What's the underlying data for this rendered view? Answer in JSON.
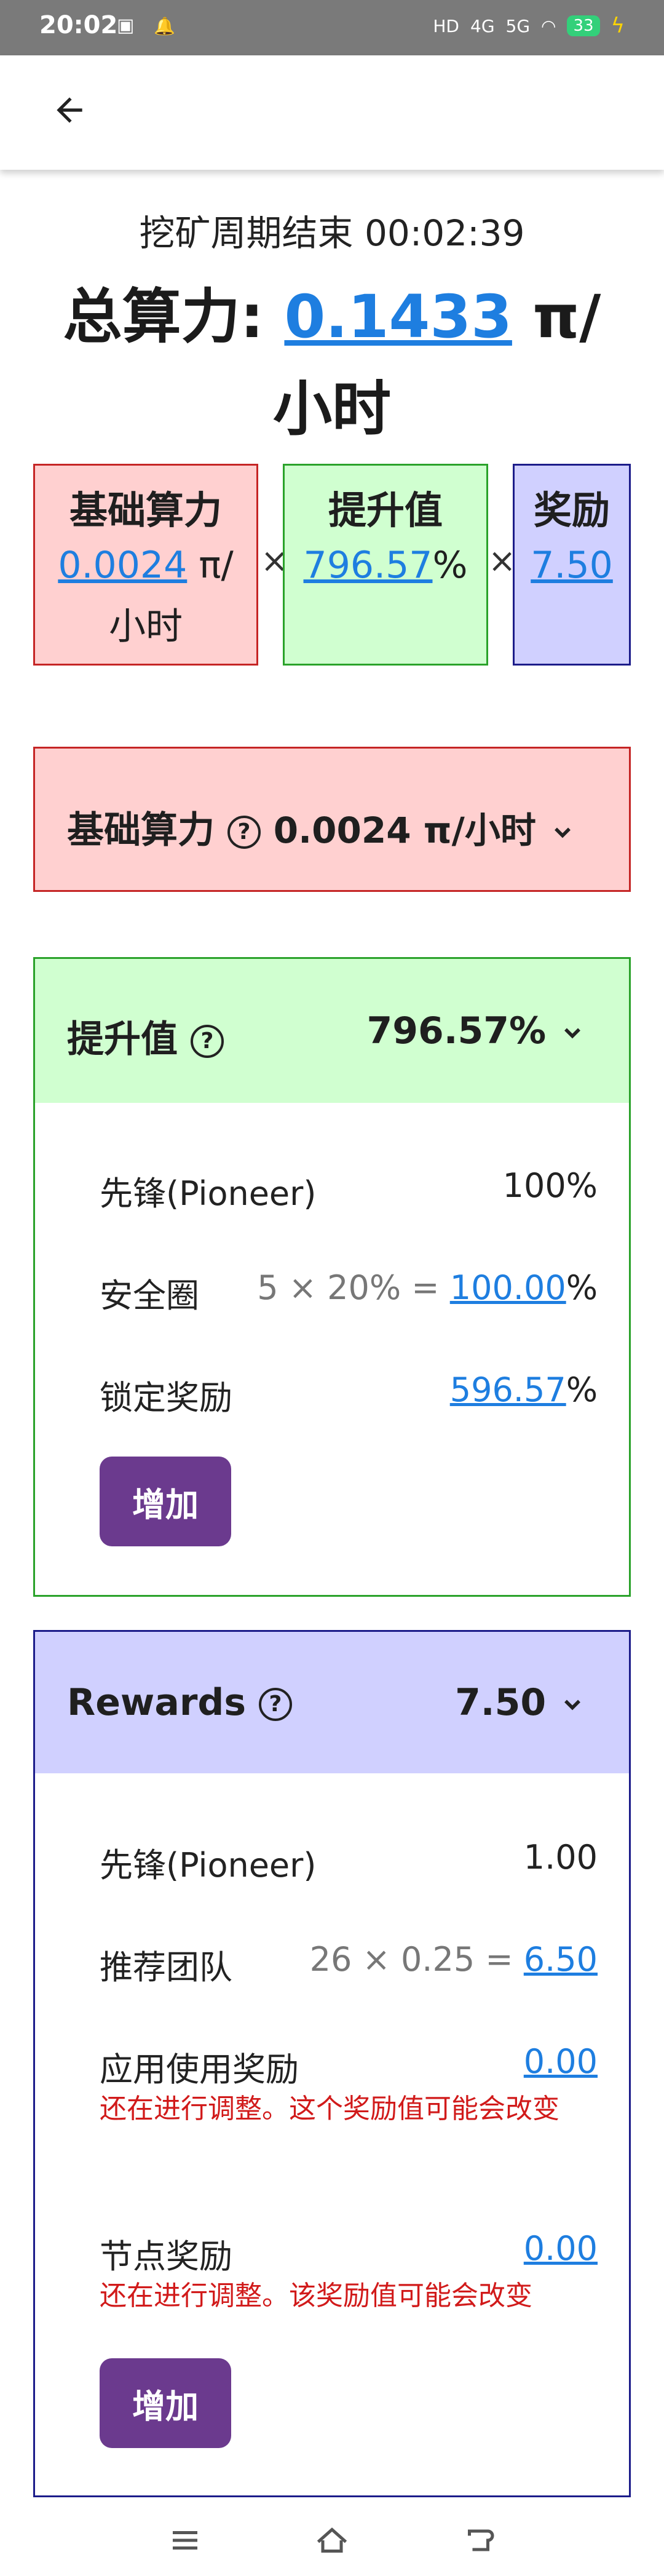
{
  "status_bar": {
    "time": "20:02",
    "notification_icons": [
      "app-notification-icon",
      "bell-icon"
    ],
    "battery_level": "33",
    "signal_labels": [
      "HD",
      "4G",
      "5G"
    ]
  },
  "header": {
    "back_icon": "arrow-left-icon"
  },
  "summary": {
    "timer_text": "挖矿周期结束 00:02:39",
    "total_label": "总算力:",
    "total_value": "0.1433",
    "total_unit": "π/小时"
  },
  "formula": {
    "base": {
      "title": "基础算力",
      "value": "0.0024",
      "unit_a": "π/",
      "unit_b": "小时"
    },
    "boost": {
      "title": "提升值",
      "value": "796.57",
      "unit": "%"
    },
    "reward": {
      "title": "奖励",
      "value": "7.50"
    },
    "times_symbol": "×"
  },
  "base_section": {
    "title": "基础算力",
    "value": "0.0024 π/小时",
    "help_icon": "question-circle-icon",
    "expand_icon": "chevron-down-icon"
  },
  "boost_section": {
    "title": "提升值",
    "value": "796.57%",
    "help_icon": "question-circle-icon",
    "expand_icon": "chevron-down-icon",
    "rows": [
      {
        "label": "先锋(Pioneer)",
        "formula": "",
        "value": "100%"
      },
      {
        "label": "安全圈",
        "formula": "5 × 20% =",
        "value_link": "100.00",
        "value_suffix": "%"
      },
      {
        "label": "锁定奖励",
        "formula": "",
        "value_link": "596.57",
        "value_suffix": "%"
      }
    ],
    "button_label": "增加"
  },
  "rewards_section": {
    "title": "Rewards",
    "value": "7.50",
    "help_icon": "question-circle-icon",
    "expand_icon": "chevron-down-icon",
    "rows": [
      {
        "label": "先锋(Pioneer)",
        "value": "1.00"
      },
      {
        "label": "推荐团队",
        "formula": "26 × 0.25 =",
        "value_link": "6.50"
      },
      {
        "label": "应用使用奖励",
        "value_link": "0.00",
        "note": "还在进行调整。这个奖励值可能会改变"
      },
      {
        "label": "节点奖励",
        "value_link": "0.00",
        "note": "还在进行调整。该奖励值可能会改变"
      }
    ],
    "button_label": "增加"
  },
  "nav_bar": {
    "icons": [
      "menu-icon",
      "home-icon",
      "back-nav-icon"
    ]
  },
  "colors": {
    "red_bg": "#ffd0d0",
    "red_border": "#c52525",
    "green_bg": "#d0ffd0",
    "green_border": "#2aa22a",
    "blue_bg": "#d0d0ff",
    "blue_border": "#1c1c8a",
    "link": "#1e7ee0",
    "button": "#6b3a8e",
    "warning": "#d11a1a"
  }
}
